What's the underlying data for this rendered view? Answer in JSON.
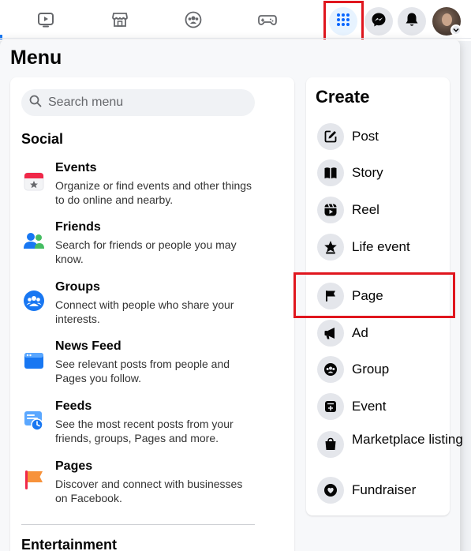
{
  "menu": {
    "title": "Menu"
  },
  "search": {
    "placeholder": "Search menu"
  },
  "social": {
    "title": "Social",
    "items": [
      {
        "title": "Events",
        "description": "Organize or find events and other things to do online and nearby."
      },
      {
        "title": "Friends",
        "description": "Search for friends or people you may know."
      },
      {
        "title": "Groups",
        "description": "Connect with people who share your interests."
      },
      {
        "title": "News Feed",
        "description": "See relevant posts from people and Pages you follow."
      },
      {
        "title": "Feeds",
        "description": "See the most recent posts from your friends, groups, Pages and more."
      },
      {
        "title": "Pages",
        "description": "Discover and connect with businesses on Facebook."
      }
    ]
  },
  "entertainment": {
    "title": "Entertainment"
  },
  "create": {
    "title": "Create",
    "items": [
      {
        "label": "Post",
        "icon": "edit-icon"
      },
      {
        "label": "Story",
        "icon": "book-icon"
      },
      {
        "label": "Reel",
        "icon": "reel-icon"
      },
      {
        "label": "Life event",
        "icon": "star-icon"
      },
      {
        "label": "Page",
        "icon": "flag-icon"
      },
      {
        "label": "Ad",
        "icon": "megaphone-icon"
      },
      {
        "label": "Group",
        "icon": "group-icon"
      },
      {
        "label": "Event",
        "icon": "calendar-plus-icon"
      },
      {
        "label": "Marketplace listing",
        "icon": "shopping-bag-icon"
      },
      {
        "label": "Fundraiser",
        "icon": "heart-hand-icon"
      }
    ]
  },
  "topbar": {
    "nav": [
      "video-icon",
      "marketplace-icon",
      "groups-icon",
      "gaming-icon"
    ],
    "actions": [
      "menu-grid-icon",
      "messenger-icon",
      "notifications-bell-icon",
      "avatar"
    ]
  },
  "colors": {
    "highlight": "#e0161e",
    "brand": "#1877f2",
    "grid_active": "#0866ff"
  }
}
